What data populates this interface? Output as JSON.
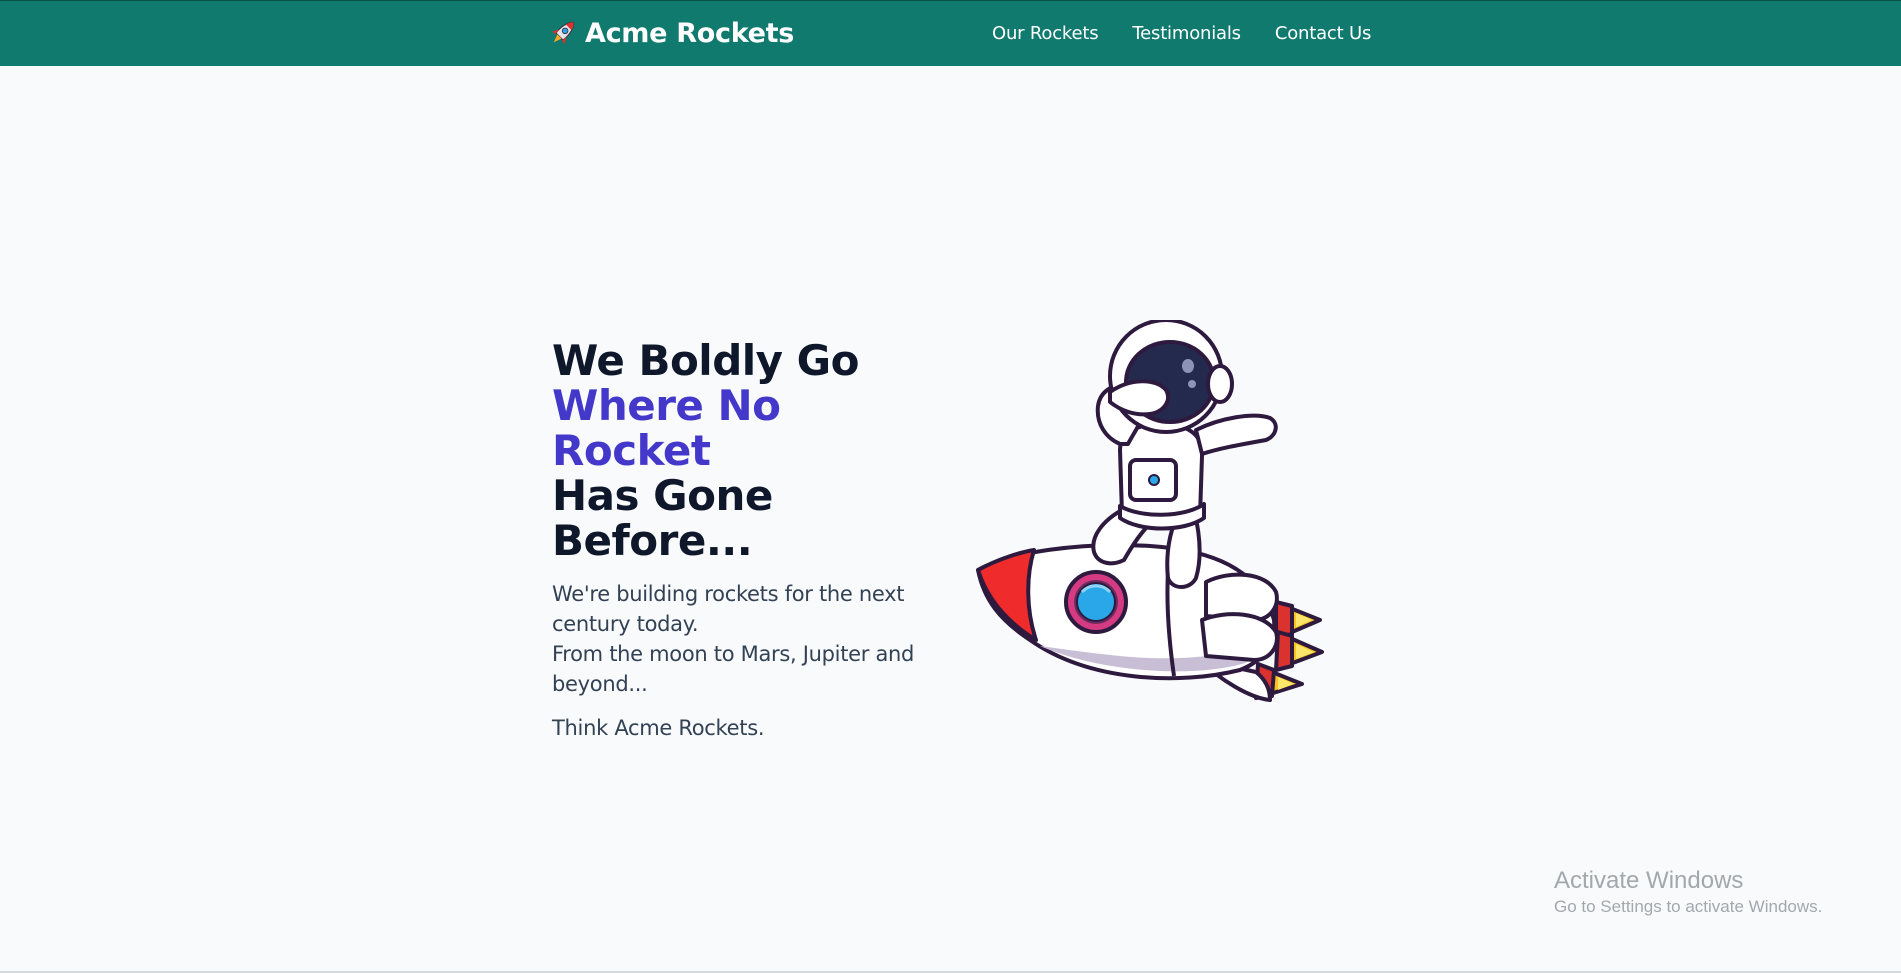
{
  "navbar": {
    "brand_title": "Acme Rockets",
    "brand_icon": "rocket-icon",
    "links": [
      {
        "label": "Our Rockets"
      },
      {
        "label": "Testimonials"
      },
      {
        "label": "Contact Us"
      }
    ],
    "background_color": "#117a6f"
  },
  "hero": {
    "headline_line1": "We Boldly Go",
    "headline_line2": "Where No Rocket",
    "headline_line3": "Has Gone",
    "headline_line4": "Before...",
    "headline_accent_color": "#4338ca",
    "description_line1": "We're building rockets for the next century today.",
    "description_line2": "From the moon to Mars, Jupiter and beyond...",
    "tagline": "Think Acme Rockets.",
    "illustration": "astronaut-riding-rocket-illustration"
  },
  "os_watermark": {
    "title": "Activate Windows",
    "subtitle": "Go to Settings to activate Windows."
  }
}
